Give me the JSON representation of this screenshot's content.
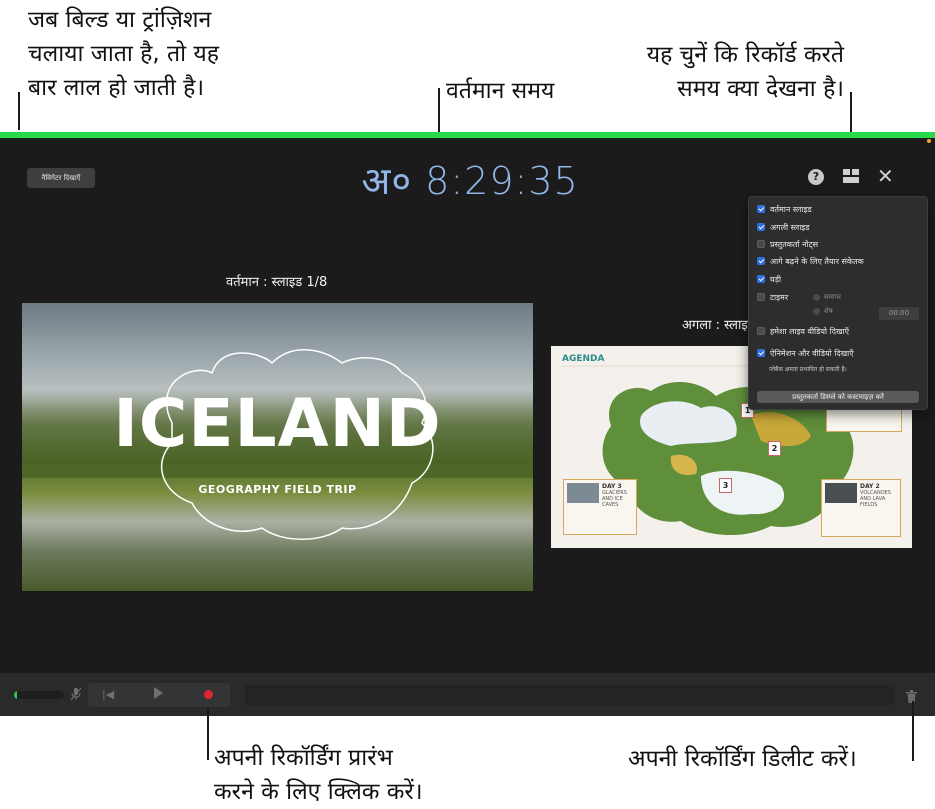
{
  "callouts": {
    "build_bar": "जब बिल्ड या ट्रांज़िशन\nचलाया जाता है, तो यह\nबार लाल हो जाती है।",
    "current_time": "वर्तमान समय",
    "choose_view": "यह चुनें कि रिकॉर्ड करते\nसमय क्या देखना है।",
    "start_recording": "अपनी रिकॉर्डिंग प्रारंभ\nकरने के लिए क्लिक करें।",
    "delete_recording": "अपनी रिकॉर्डिंग डिलीट करें।"
  },
  "screen": {
    "build_bar_color": "#27d84a",
    "navigator_button": "नैविगेटर दिखाएँ",
    "clock": "अ० 8:29:35",
    "help_icon": "?",
    "close_icon": "✕",
    "current_label": "वर्तमान : स्लाइड 1/8",
    "next_label": "अगला : स्लाइड",
    "current_slide": {
      "title": "ICELAND",
      "subtitle": "GEOGRAPHY FIELD TRIP"
    },
    "next_slide": {
      "title": "AGENDA",
      "markers": [
        "1",
        "2",
        "3"
      ],
      "day3_title": "DAY 3",
      "day3_sub": "GLACIERS AND ICE CAVES",
      "day2_title": "DAY 2",
      "day2_sub": "VOLCANOES AND LAVA FIELDS"
    }
  },
  "options_panel": {
    "items": [
      {
        "label": "वर्तमान स्लाइड",
        "checked": true
      },
      {
        "label": "अगली स्लाइड",
        "checked": true
      },
      {
        "label": "प्रस्तुतकर्ता नोट्स",
        "checked": false
      },
      {
        "label": "आगे बढ़ने के लिए तैयार संकेतक",
        "checked": true
      },
      {
        "label": "घड़ी",
        "checked": true
      },
      {
        "label": "टाइमर",
        "checked": false
      },
      {
        "label": "हमेशा लाइव वीडियो दिखाएँ",
        "checked": false
      },
      {
        "label": "ऐनिमेशन और वीडियो दिखाएँ",
        "checked": true
      }
    ],
    "radio_elapsed": "समाप्त",
    "radio_remaining": "शेष",
    "timer_value": "00:00",
    "perf_note": "प्लेबैक क्षमता प्रभावित हो सकती है।",
    "customize_button": "प्रस्तुतकर्ता डिस्प्ले को कस्टमाइज़ करें"
  },
  "control_bar": {
    "audio_level": 0.05,
    "skip_back_icon": "|◀",
    "trash_icon": "trash-icon",
    "record_color": "#e0262e"
  }
}
